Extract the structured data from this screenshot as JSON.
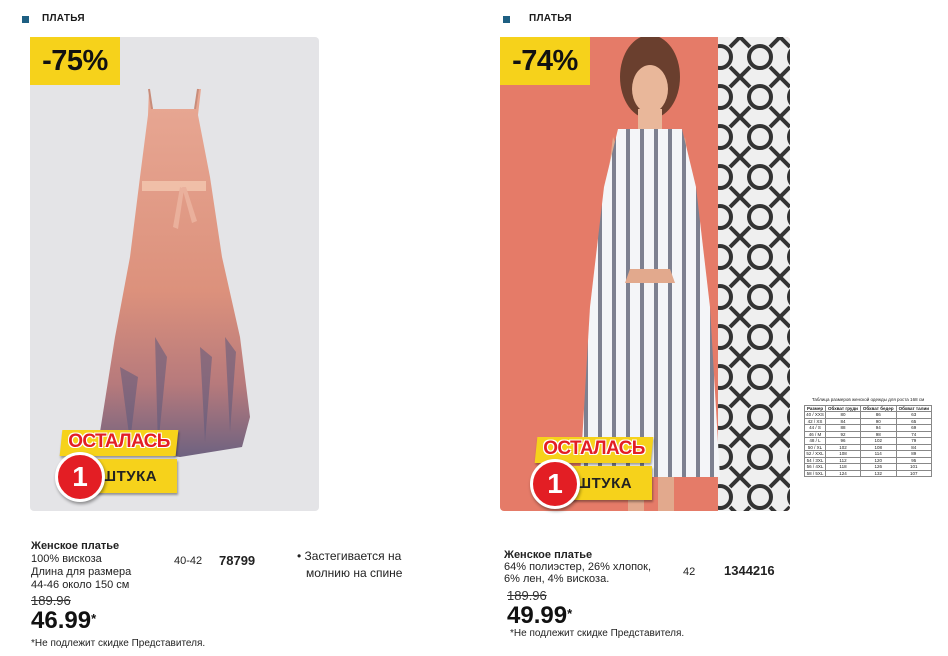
{
  "left": {
    "section_title": "ПЛАТЬЯ",
    "discount": "-75%",
    "badge": {
      "line1": "ОСТАЛАСЬ",
      "number": "1",
      "line2": "ШТУКА"
    },
    "product": {
      "name": "Женское платье",
      "lines": [
        "100% вискоза",
        "Длина для размера",
        "44-46  около 150 см"
      ],
      "sizes": "40-42",
      "code": "78799",
      "feature_lines": [
        "• Застегивается на",
        "молнию на спине"
      ],
      "old_price": "189.96",
      "price": "46.99",
      "price_mark": "*",
      "note": "*Не подлежит скидке  Представителя."
    }
  },
  "right": {
    "section_title": "ПЛАТЬЯ",
    "discount": "-74%",
    "badge": {
      "line1": "ОСТАЛАСЬ",
      "number": "1",
      "line2": "ШТУКА"
    },
    "product": {
      "name": "Женское платье",
      "lines": [
        "64% полиэстер, 26% хлопок,",
        "6% лен, 4% вискоза."
      ],
      "sizes": "42",
      "code": "1344216",
      "old_price": "189.96",
      "price": "49.99",
      "price_mark": "*",
      "note": "*Не подлежит скидке  Представителя."
    }
  },
  "size_table": {
    "caption": "Таблица размеров женской одежды для роста 168 см",
    "headers": [
      "Размер",
      "Обхват груди",
      "Обхват бедер",
      "Обхват талии"
    ],
    "rows": [
      [
        "40 / XXS",
        "80",
        "86",
        "63"
      ],
      [
        "42 / XS",
        "84",
        "90",
        "65"
      ],
      [
        "44 / S",
        "88",
        "94",
        "69"
      ],
      [
        "46 / M",
        "92",
        "98",
        "74"
      ],
      [
        "48 / L",
        "96",
        "102",
        "79"
      ],
      [
        "50 / XL",
        "102",
        "108",
        "84"
      ],
      [
        "52 / XXL",
        "108",
        "114",
        "89"
      ],
      [
        "54 / 3XL",
        "112",
        "120",
        "95"
      ],
      [
        "56 / 4XL",
        "118",
        "126",
        "101"
      ],
      [
        "58 / 5XL",
        "124",
        "132",
        "107"
      ]
    ]
  },
  "colors": {
    "badge_yellow": "#f6d21b",
    "badge_red": "#e31e24",
    "marker_blue": "#1e5f82"
  }
}
